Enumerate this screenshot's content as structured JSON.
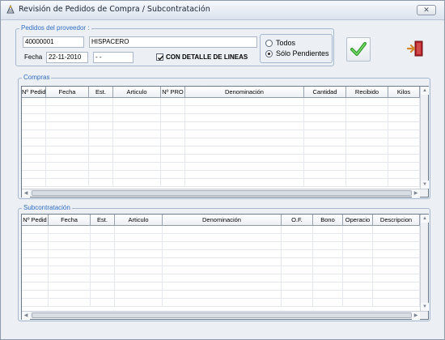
{
  "window": {
    "title": "Revisión de Pedidos de Compra / Subcontratación",
    "close_glyph": "✕"
  },
  "proveedor": {
    "legend": "Pedidos del proveedor :",
    "code": "40000001",
    "name": "HISPACERO",
    "fecha_label": "Fecha",
    "fecha_value": "22-11-2010",
    "fecha_hasta": " -  -",
    "detalle_label": "CON DETALLE DE LINEAS",
    "detalle_checked": true
  },
  "filter": {
    "options": [
      {
        "label": "Todos",
        "selected": false
      },
      {
        "label": "Sólo Pendientes",
        "selected": true
      }
    ]
  },
  "actions": {
    "accept_icon": "green-checkmark-icon",
    "exit_icon": "exit-door-icon"
  },
  "compras": {
    "legend": "Compras",
    "columns": [
      "Nº Pedid",
      "Fecha",
      "Est.",
      "Articulo",
      "Nº PRO",
      "Denominación",
      "Cantidad",
      "Recibido",
      "Kilos"
    ],
    "scroll_left": "◀",
    "scroll_right": "▶",
    "scroll_up": "▲",
    "scroll_down": "▼"
  },
  "subcontratacion": {
    "legend": "Subcontratación",
    "columns": [
      "Nº Pedid",
      "Fecha",
      "Est.",
      "Articulo",
      "Denominación",
      "O.F.",
      "Bono",
      "Operacio",
      "Descripcion"
    ],
    "scroll_left": "◀",
    "scroll_right": "▶",
    "scroll_up": "▲",
    "scroll_down": "▼"
  }
}
